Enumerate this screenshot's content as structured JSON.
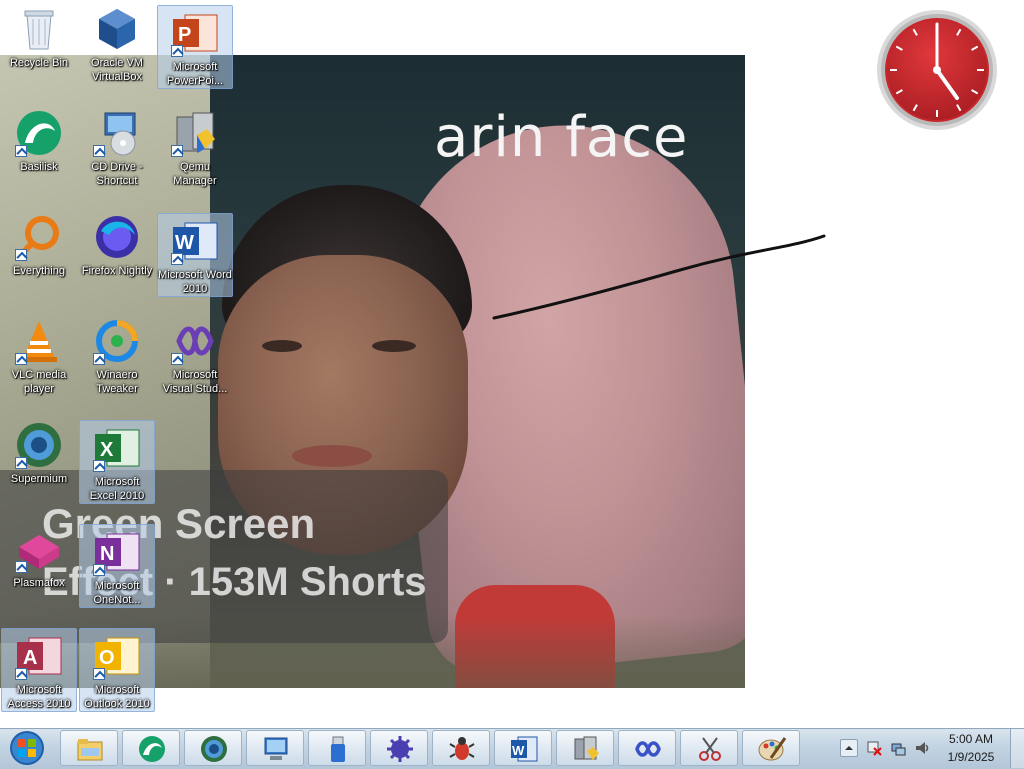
{
  "wallpaper": {
    "title": "arin face",
    "banner_line1": "Green Screen",
    "banner_line2": "Effect · 153M Shorts"
  },
  "desktop_icons": [
    {
      "label": "Recycle Bin",
      "icon": "recycle-bin-icon"
    },
    {
      "label": "Oracle VM VirtualBox",
      "icon": "virtualbox-icon"
    },
    {
      "label": "Microsoft PowerPoi...",
      "icon": "powerpoint-icon"
    },
    {
      "label": "Basilisk",
      "icon": "basilisk-icon"
    },
    {
      "label": "CD Drive - Shortcut",
      "icon": "cd-drive-icon"
    },
    {
      "label": "Qemu Manager",
      "icon": "qemu-manager-icon"
    },
    {
      "label": "Everything",
      "icon": "everything-search-icon"
    },
    {
      "label": "Firefox Nightly",
      "icon": "firefox-nightly-icon"
    },
    {
      "label": "Microsoft Word 2010",
      "icon": "word-icon"
    },
    {
      "label": "VLC media player",
      "icon": "vlc-icon"
    },
    {
      "label": "Winaero Tweaker",
      "icon": "winaero-tweaker-icon"
    },
    {
      "label": "Microsoft Visual Stud...",
      "icon": "visual-studio-icon"
    },
    {
      "label": "Supermium",
      "icon": "supermium-icon"
    },
    {
      "label": "Microsoft Excel 2010",
      "icon": "excel-icon"
    },
    {
      "label": "Plasmafox",
      "icon": "plasmafox-icon"
    },
    {
      "label": "Microsoft OneNot...",
      "icon": "onenote-icon"
    },
    {
      "label": "Microsoft Access 2010",
      "icon": "access-icon"
    },
    {
      "label": "Microsoft Outlook 2010",
      "icon": "outlook-icon"
    }
  ],
  "taskbar": {
    "pinned": [
      "file-explorer-icon",
      "basilisk-icon",
      "supermium-icon",
      "control-panel-icon",
      "usb-drive-icon",
      "gear-virus-icon",
      "bug-app-icon",
      "word-icon",
      "qemu-manager-icon",
      "infinity-app-icon",
      "snipping-tool-icon",
      "paint-icon"
    ],
    "time": "5:00 AM",
    "date": "1/9/2025"
  },
  "colors": {
    "taskbar": "#c2d3e2",
    "clock_face": "#c8262b",
    "selection": "#b4cdeb"
  }
}
